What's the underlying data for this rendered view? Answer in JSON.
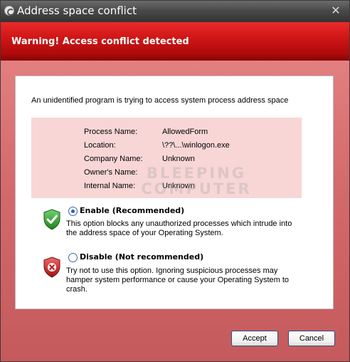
{
  "window": {
    "title": "Address space conflict",
    "close_glyph": "✕"
  },
  "banner": {
    "text": "Warning! Access conflict detected"
  },
  "intro_text": "An unidentified program is trying to access system process address space",
  "details": [
    {
      "label": "Process Name:",
      "value": "AllowedForm"
    },
    {
      "label": "Location:",
      "value": "\\??\\...\\winlogon.exe"
    },
    {
      "label": "Company Name:",
      "value": "Unknown"
    },
    {
      "label": "Owner's Name:",
      "value": ""
    },
    {
      "label": "Internal Name:",
      "value": "Unknown"
    }
  ],
  "watermark": {
    "line1": "BLEEPING",
    "line2": "COMPUTER"
  },
  "options": {
    "enable": {
      "label": "Enable (Recommended)",
      "checked": true,
      "icon": "green-shield-check-icon",
      "description": "This option blocks any unauthorized processes which intrude into the address space of your Operating System."
    },
    "disable": {
      "label": "Disable (Not recommended)",
      "checked": false,
      "icon": "red-shield-x-icon",
      "description": "Try not to use this option. Ignoring suspicious processes may hamper system performance or cause your Operating System to crash."
    }
  },
  "buttons": {
    "accept": "Accept",
    "cancel": "Cancel"
  },
  "colors": {
    "banner_red": "#d01616",
    "body_red": "#d46a6c",
    "info_box": "#f8d6d6",
    "shield_green": "#2f9a2f",
    "shield_red": "#c81e1e"
  }
}
